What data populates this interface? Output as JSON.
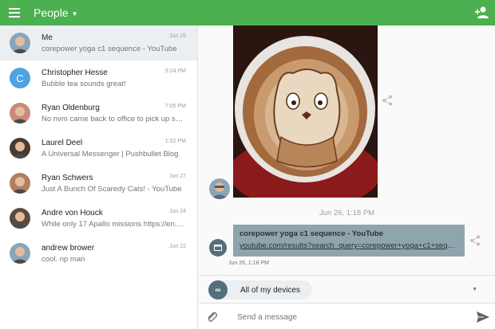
{
  "appbar": {
    "title": "People",
    "menu_icon": "hamburger-icon",
    "add_icon": "add-person-icon",
    "color": "#4caf50"
  },
  "conversations": [
    {
      "name": "Me",
      "preview": "corepower yoga c1 sequence - YouTube",
      "time": "Jun 26",
      "avatar": "photo",
      "active": true
    },
    {
      "name": "Christopher Hesse",
      "preview": "Bubble tea sounds great!",
      "time": "9:24 PM",
      "avatar": "C"
    },
    {
      "name": "Ryan Oldenburg",
      "preview": "No nvm came back to office to pick up some stuff",
      "time": "7:05 PM",
      "avatar": "photo"
    },
    {
      "name": "Laurel Deel",
      "preview": "A Universal Messenger | Pushbullet Blog",
      "time": "1:52 PM",
      "avatar": "photo"
    },
    {
      "name": "Ryan Schwers",
      "preview": "Just A Bunch Of Scaredy Cats! - YouTube",
      "time": "Jun 27",
      "avatar": "photo"
    },
    {
      "name": "Andre von Houck",
      "preview": "While only 17 Apallo missions https://en.wikipedia.org",
      "time": "Jun 24",
      "avatar": "photo"
    },
    {
      "name": "andrew brower",
      "preview": "cool. np man",
      "time": "Jun 22",
      "avatar": "photo"
    }
  ],
  "thread": {
    "timestamp": "Jun 26, 1:18 PM",
    "link": {
      "title": "corepower yoga c1 sequence - YouTube",
      "url": "youtube.com/results?search_query=corepower+yoga+c1+sequence",
      "time": "Jun 26, 1:18 PM"
    }
  },
  "devices": {
    "label": "All of my devices",
    "icon_text": "∞"
  },
  "composer": {
    "placeholder": "Send a message",
    "attach_icon": "paperclip-icon",
    "send_icon": "send-icon"
  }
}
